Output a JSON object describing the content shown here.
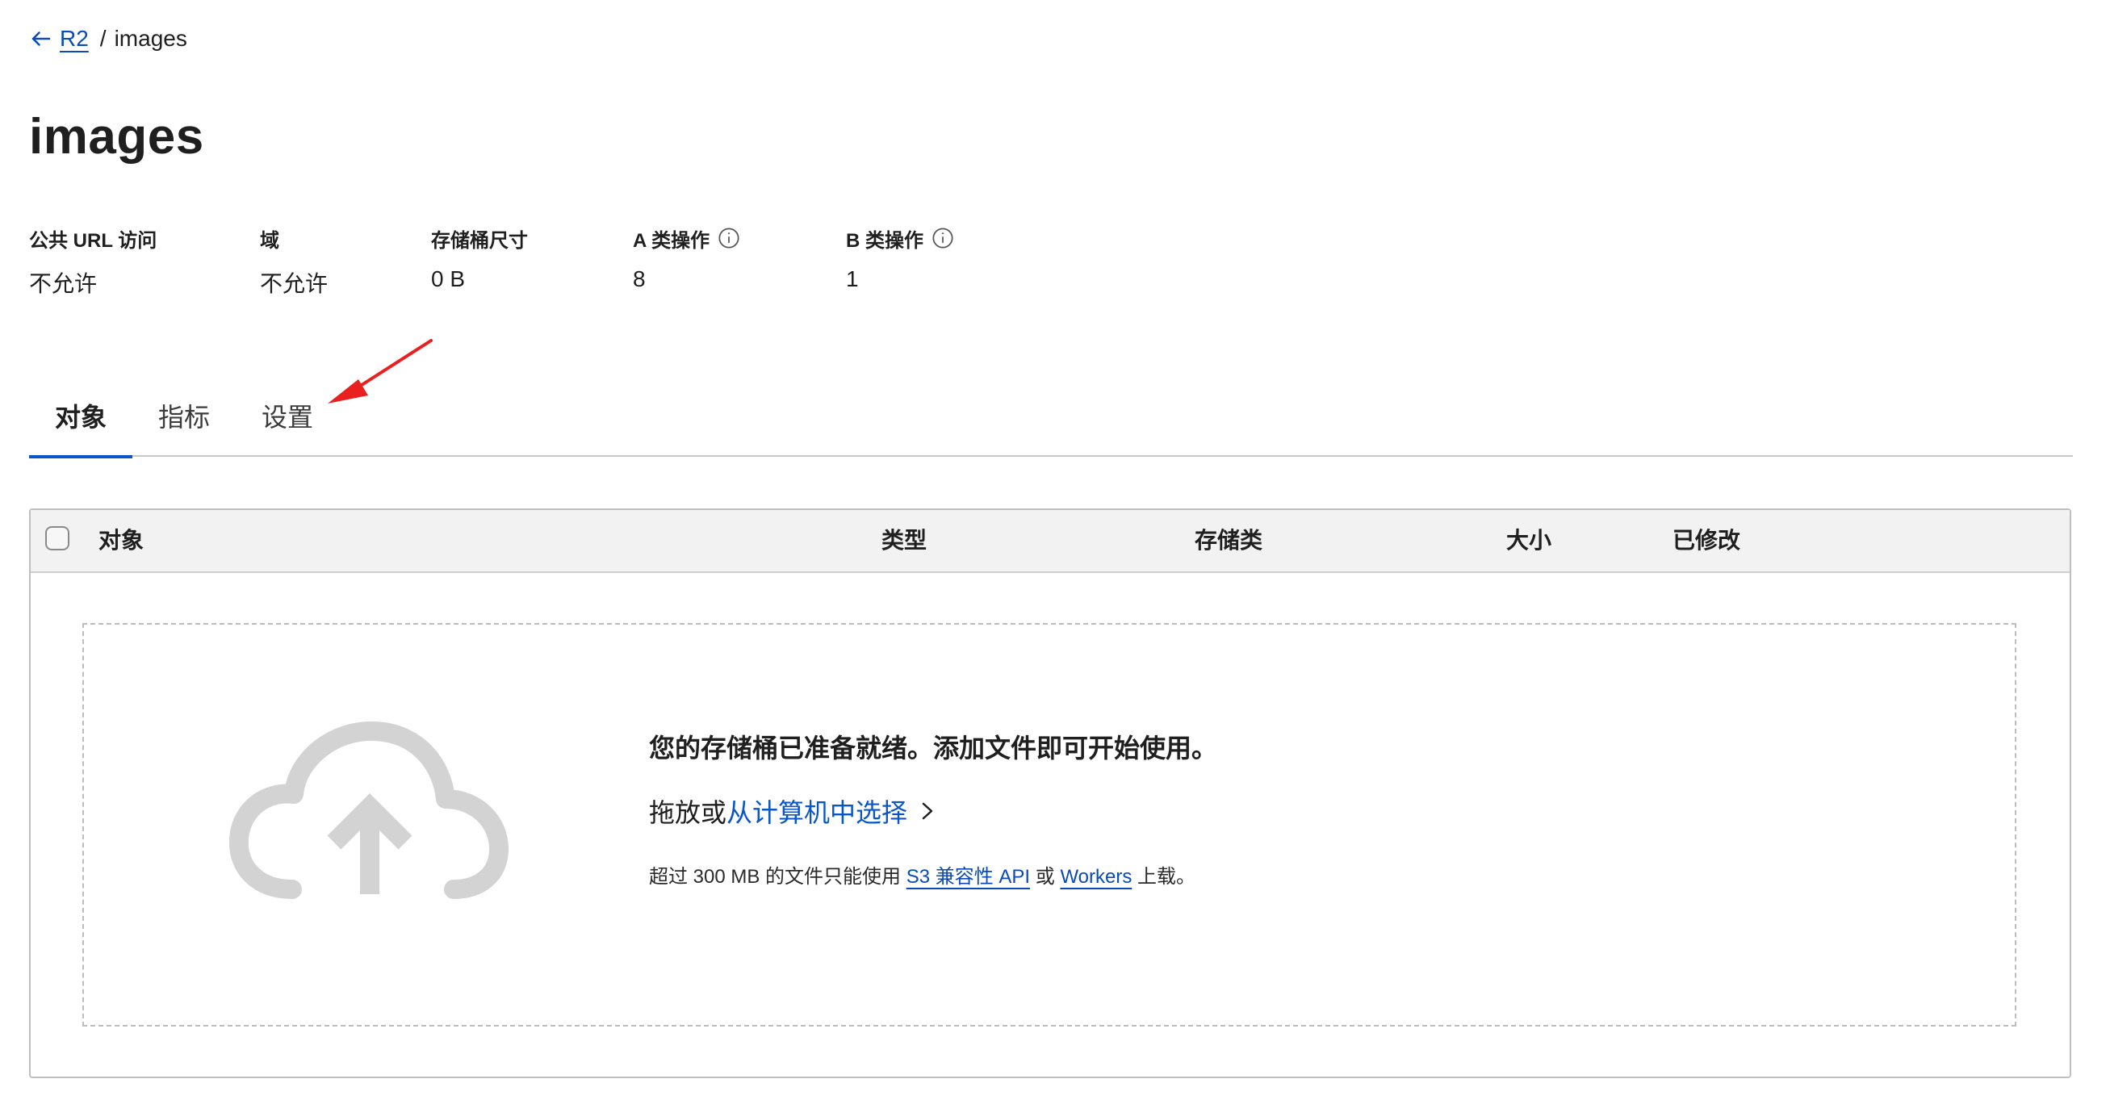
{
  "breadcrumb": {
    "back_label": "R2",
    "separator": "/",
    "current": "images"
  },
  "page_title": "images",
  "stats": [
    {
      "label": "公共 URL 访问",
      "value": "不允许",
      "info": false
    },
    {
      "label": "域",
      "value": "不允许",
      "info": false
    },
    {
      "label": "存储桶尺寸",
      "value": "0 B",
      "info": false
    },
    {
      "label": "A 类操作",
      "value": "8",
      "info": true
    },
    {
      "label": "B 类操作",
      "value": "1",
      "info": true
    }
  ],
  "tabs": [
    {
      "label": "对象",
      "active": true
    },
    {
      "label": "指标",
      "active": false
    },
    {
      "label": "设置",
      "active": false
    }
  ],
  "table": {
    "columns": [
      "对象",
      "类型",
      "存储类",
      "大小",
      "已修改"
    ]
  },
  "empty_state": {
    "heading": "您的存储桶已准备就绪。添加文件即可开始使用。",
    "drag_prefix": "拖放或",
    "drag_link": "从计算机中选择",
    "note_prefix": "超过 300 MB 的文件只能使用 ",
    "note_link1": "S3 兼容性 API",
    "note_middle": " 或 ",
    "note_link2": "Workers",
    "note_suffix": " 上载。"
  },
  "colors": {
    "link": "#0a55c8",
    "active_tab_underline": "#0a55c8",
    "annotation_arrow": "#e8201f",
    "cloud_icon": "#d3d3d3"
  },
  "icons": [
    "arrow-left-icon",
    "info-icon",
    "cloud-upload-icon",
    "chevron-right-icon",
    "annotation-arrow"
  ]
}
